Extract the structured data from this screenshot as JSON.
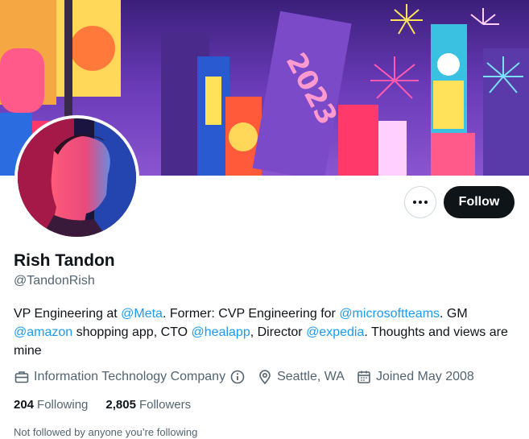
{
  "profile": {
    "name": "Rish Tandon",
    "handle": "@TandonRish",
    "bio": {
      "p1": "VP Engineering at ",
      "m1": "@Meta",
      "p2": ". Former: CVP Engineering for ",
      "m2": "@microsoftteams",
      "p3": ". GM ",
      "m3": "@amazon",
      "p4": " shopping app,  CTO ",
      "m4": "@healapp",
      "p5": ", Director ",
      "m5": "@expedia",
      "p6": ". Thoughts and views are mine"
    },
    "category": "Information Technology Company",
    "location": "Seattle, WA",
    "joined": "Joined May 2008",
    "following_count": "204",
    "following_label": "Following",
    "followers_count": "2,805",
    "followers_label": "Followers",
    "not_followed_text": "Not followed by anyone you’re following"
  },
  "banner": {
    "year_text": "2023"
  },
  "actions": {
    "follow_label": "Follow",
    "more_icon": "more-horizontal-icon"
  },
  "colors": {
    "link": "#1d9bf0",
    "text": "#0f1419",
    "secondary": "#536471",
    "button": "#0f1419"
  }
}
